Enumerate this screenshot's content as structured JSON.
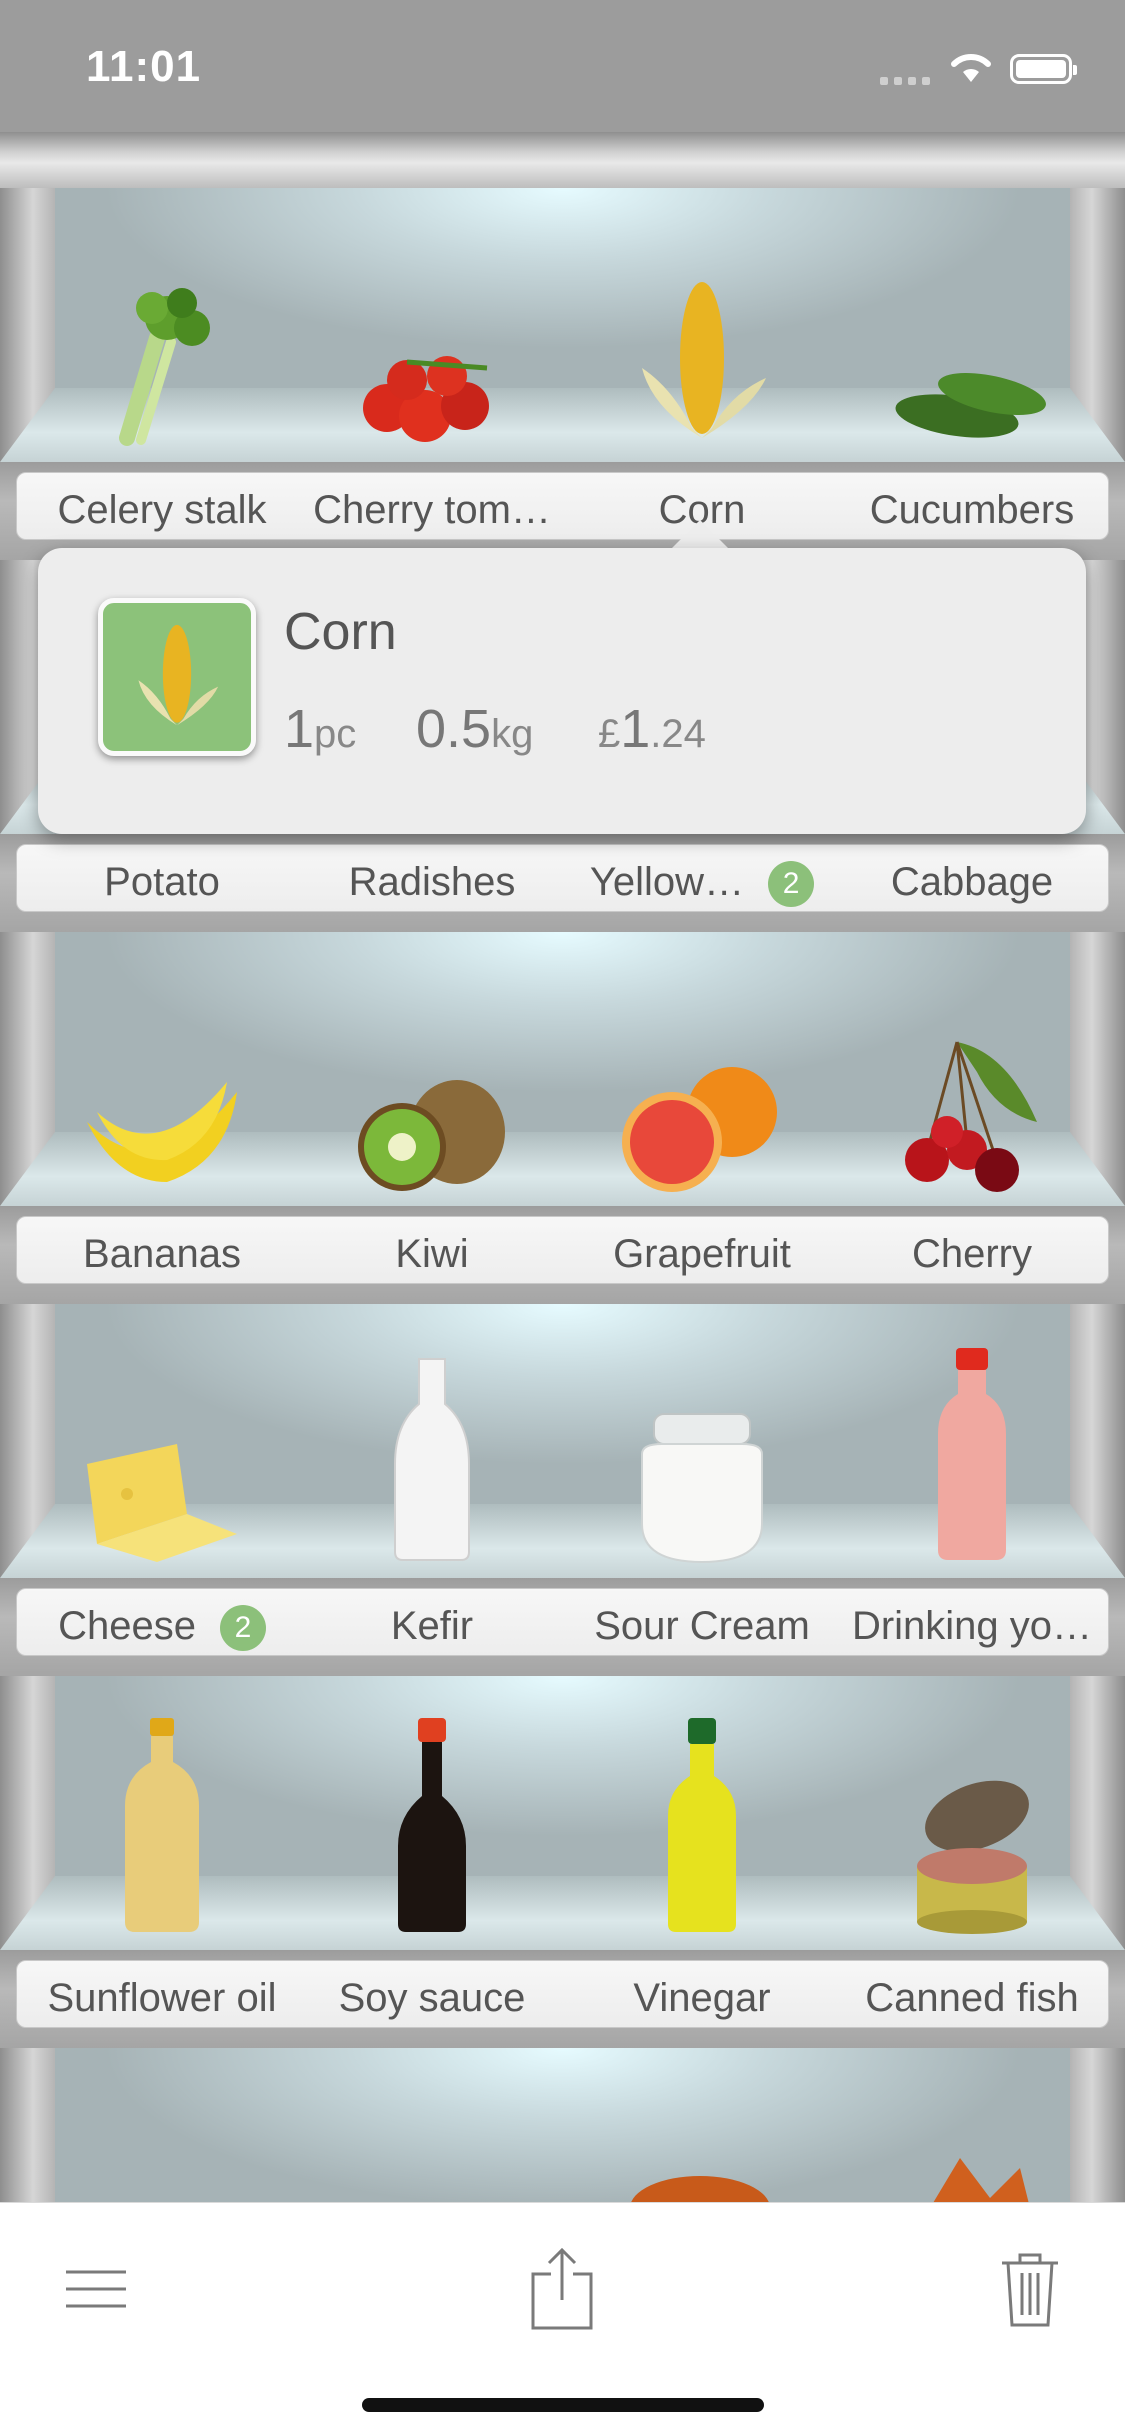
{
  "status_bar": {
    "time": "11:01"
  },
  "popover": {
    "title": "Corn",
    "quantity_value": "1",
    "quantity_unit": "pc",
    "weight_value": "0.5",
    "weight_unit": "kg",
    "price_currency": "£",
    "price_main": "1",
    "price_fraction": ".24"
  },
  "shelves": [
    {
      "items": [
        {
          "label": "Celery stalk",
          "icon": "celery-icon"
        },
        {
          "label": "Cherry tom…",
          "icon": "tomatoes-icon"
        },
        {
          "label": "Corn",
          "icon": "corn-icon"
        },
        {
          "label": "Cucumbers",
          "icon": "cucumbers-icon"
        }
      ]
    },
    {
      "items": [
        {
          "label": "Potato",
          "icon": "potato-icon"
        },
        {
          "label": "Radishes",
          "icon": "radishes-icon"
        },
        {
          "label": "Yellow…",
          "icon": "yellow-icon",
          "badge": "2"
        },
        {
          "label": "Cabbage",
          "icon": "cabbage-icon"
        }
      ]
    },
    {
      "items": [
        {
          "label": "Bananas",
          "icon": "bananas-icon"
        },
        {
          "label": "Kiwi",
          "icon": "kiwi-icon"
        },
        {
          "label": "Grapefruit",
          "icon": "grapefruit-icon"
        },
        {
          "label": "Cherry",
          "icon": "cherry-icon"
        }
      ]
    },
    {
      "items": [
        {
          "label": "Cheese",
          "icon": "cheese-icon",
          "badge": "2"
        },
        {
          "label": "Kefir",
          "icon": "kefir-bottle-icon"
        },
        {
          "label": "Sour Cream",
          "icon": "sour-cream-jar-icon"
        },
        {
          "label": "Drinking yo…",
          "icon": "drinking-yogurt-bottle-icon"
        }
      ]
    },
    {
      "items": [
        {
          "label": "Sunflower oil",
          "icon": "sunflower-oil-bottle-icon"
        },
        {
          "label": "Soy sauce",
          "icon": "soy-sauce-bottle-icon"
        },
        {
          "label": "Vinegar",
          "icon": "vinegar-bottle-icon"
        },
        {
          "label": "Canned fish",
          "icon": "canned-fish-icon"
        }
      ]
    }
  ],
  "toolbar": {
    "menu_icon": "menu-icon",
    "share_icon": "share-icon",
    "trash_icon": "trash-icon"
  },
  "colors": {
    "badge": "#8cc07a",
    "thumb_bg": "#8cc27a",
    "label_text": "#555555"
  }
}
